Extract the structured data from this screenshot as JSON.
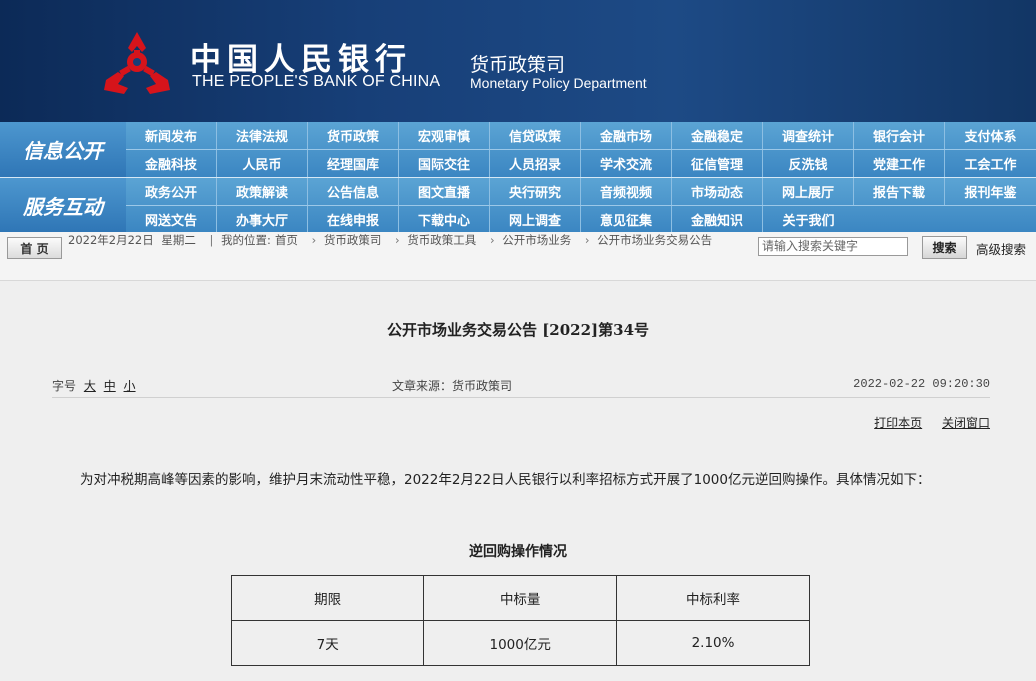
{
  "header": {
    "title_cn": "中国人民银行",
    "title_en": "THE PEOPLE'S BANK OF CHINA",
    "dept_cn": "货币政策司",
    "dept_en": "Monetary Policy Department",
    "emblem_icon": "pboc-emblem-icon",
    "emblem_color": "#d6141b"
  },
  "nav": {
    "group1": {
      "label": "信息公开",
      "row1": [
        "新闻发布",
        "法律法规",
        "货币政策",
        "宏观审慎",
        "信贷政策",
        "金融市场",
        "金融稳定",
        "调查统计",
        "银行会计",
        "支付体系"
      ],
      "row2": [
        "金融科技",
        "人民币",
        "经理国库",
        "国际交往",
        "人员招录",
        "学术交流",
        "征信管理",
        "反洗钱",
        "党建工作",
        "工会工作"
      ]
    },
    "group2": {
      "label": "服务互动",
      "row1": [
        "政务公开",
        "政策解读",
        "公告信息",
        "图文直播",
        "央行研究",
        "音频视频",
        "市场动态",
        "网上展厅",
        "报告下载",
        "报刊年鉴"
      ],
      "row2": [
        "网送文告",
        "办事大厅",
        "在线申报",
        "下载中心",
        "网上调查",
        "意见征集",
        "金融知识",
        "关于我们"
      ]
    }
  },
  "crumb": {
    "home": "首 页",
    "date": "2022年2月22日",
    "weekday": "星期二",
    "location_prefix": "我的位置:",
    "items": [
      "首页",
      "货币政策司",
      "货币政策工具",
      "公开市场业务",
      "公开市场业务交易公告"
    ],
    "search_placeholder": "请输入搜索关键字",
    "search_button": "搜索",
    "advanced": "高级搜索"
  },
  "article": {
    "title": "公开市场业务交易公告 [2022]第34号",
    "font_label": "字号",
    "size_large": "大",
    "size_medium": "中",
    "size_small": "小",
    "source": "文章来源：货币政策司",
    "time": "2022-02-22  09:20:30",
    "print": "打印本页",
    "close": "关闭窗口",
    "paragraph": "为对冲税期高峰等因素的影响，维护月末流动性平稳，2022年2月22日人民银行以利率招标方式开展了1000亿元逆回购操作。具体情况如下：",
    "table_title": "逆回购操作情况",
    "table": {
      "headers": [
        "期限",
        "中标量",
        "中标利率"
      ],
      "rows": [
        [
          "7天",
          "1000亿元",
          "2.10%"
        ]
      ]
    }
  }
}
